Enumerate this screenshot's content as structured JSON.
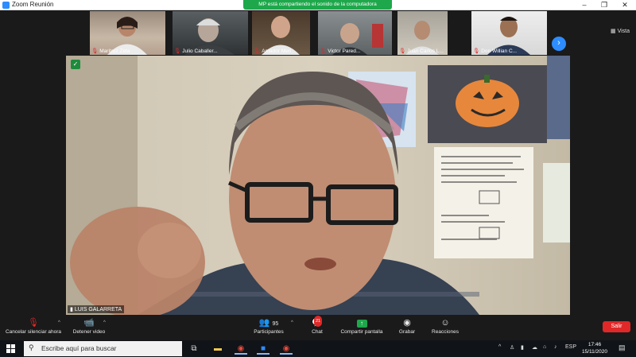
{
  "window": {
    "title": "Zoom Reunión",
    "minimize": "–",
    "maximize": "❐",
    "close": "✕"
  },
  "share_banner": "MP está compartiendo el sonido de la computadora",
  "view_label": "Vista",
  "participants": [
    {
      "name": "Maritruz Zeta"
    },
    {
      "name": "Julio Caballer..."
    },
    {
      "name": "Amador Meri..."
    },
    {
      "name": "Victor Pared..."
    },
    {
      "name": "Juan Carlos L..."
    },
    {
      "name": "Don Willian C..."
    }
  ],
  "speaker": {
    "name": "LUIS GALARRETA"
  },
  "toolbar": {
    "mute_label": "Cancelar silenciar ahora",
    "video_label": "Detener video",
    "participants_label": "Participantes",
    "participants_count": "95",
    "chat_label": "Chat",
    "chat_badge": "21",
    "share_label": "Compartir pantalla",
    "record_label": "Grabar",
    "reactions_label": "Reacciones",
    "leave_label": "Salir"
  },
  "taskbar": {
    "search_placeholder": "Escribe aquí para buscar",
    "lang": "ESP",
    "time": "17:46",
    "date": "15/11/2020"
  },
  "colors": {
    "share_green": "#1ea84b",
    "zoom_blue": "#2d8cff",
    "leave_red": "#e02828"
  }
}
